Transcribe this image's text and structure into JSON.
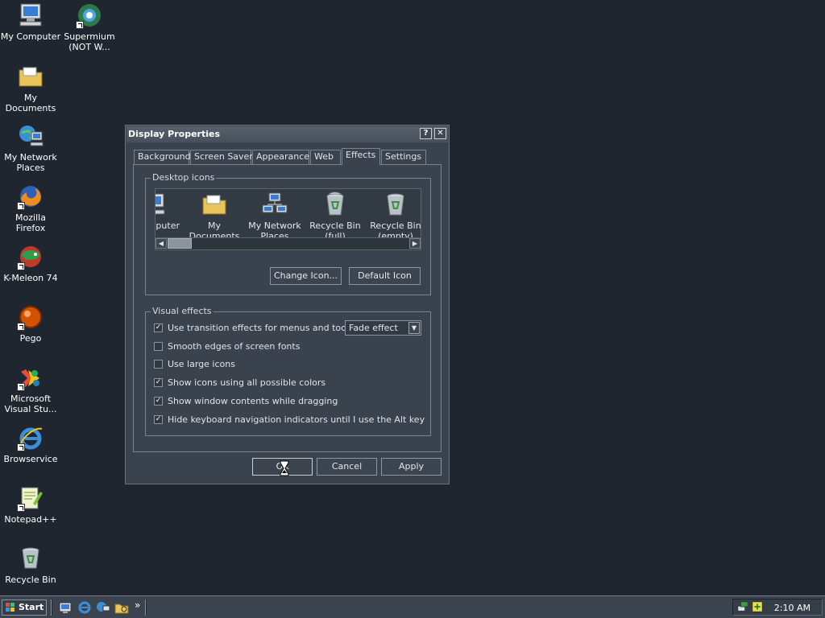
{
  "desktop": {
    "icons": [
      {
        "label": "My Computer",
        "icon": "computer-icon"
      },
      {
        "label": "Supermium (NOT W...",
        "icon": "supermium-icon"
      },
      {
        "label": "My Documents",
        "icon": "folder-icon"
      },
      {
        "label": "My Network Places",
        "icon": "network-icon"
      },
      {
        "label": "Mozilla Firefox",
        "icon": "firefox-icon"
      },
      {
        "label": "K-Meleon 74",
        "icon": "kmeleon-icon"
      },
      {
        "label": "Pego",
        "icon": "pego-icon"
      },
      {
        "label": "Microsoft Visual Stu...",
        "icon": "visual-studio-icon"
      },
      {
        "label": "Browservice",
        "icon": "ie-icon"
      },
      {
        "label": "Notepad++",
        "icon": "notepad-icon"
      },
      {
        "label": "Recycle Bin",
        "icon": "recycle-bin-icon"
      }
    ]
  },
  "dialog": {
    "title": "Display Properties",
    "help_button": "?",
    "close_button": "✕",
    "tabs": [
      "Background",
      "Screen Saver",
      "Appearance",
      "Web",
      "Effects",
      "Settings"
    ],
    "active_tab": "Effects",
    "desktop_icons": {
      "label": "Desktop icons",
      "items": [
        {
          "label": "mputer",
          "icon": "computer-icon"
        },
        {
          "label": "My Documents",
          "icon": "folder-icon"
        },
        {
          "label": "My Network Places",
          "icon": "network-icon"
        },
        {
          "label": "Recycle Bin (full)",
          "icon": "recycle-bin-full-icon"
        },
        {
          "label": "Recycle Bin (empty)",
          "icon": "recycle-bin-empty-icon"
        }
      ],
      "change_icon_button": "Change Icon...",
      "default_icon_button": "Default Icon"
    },
    "visual_effects": {
      "label": "Visual effects",
      "options": [
        {
          "label": "Use transition effects for menus and tooltips",
          "checked": true
        },
        {
          "label": "Smooth edges of screen fonts",
          "checked": false
        },
        {
          "label": "Use large icons",
          "checked": false
        },
        {
          "label": "Show icons using all possible colors",
          "checked": true
        },
        {
          "label": "Show window contents while dragging",
          "checked": true
        },
        {
          "label": "Hide keyboard navigation indicators until I use the Alt key",
          "checked": true
        }
      ],
      "transition_select": "Fade effect"
    },
    "buttons": {
      "ok": "OK",
      "cancel": "Cancel",
      "apply": "Apply"
    }
  },
  "taskbar": {
    "start_label": "Start",
    "quick_launch": [
      "show-desktop-icon",
      "ie-icon",
      "network-icon",
      "folder-search-icon"
    ],
    "chevron": "»",
    "clock": "2:10 AM"
  },
  "colors": {
    "desktop": "#1f2630",
    "dialog": "#3a434d",
    "taskbar": "#3b444e"
  }
}
